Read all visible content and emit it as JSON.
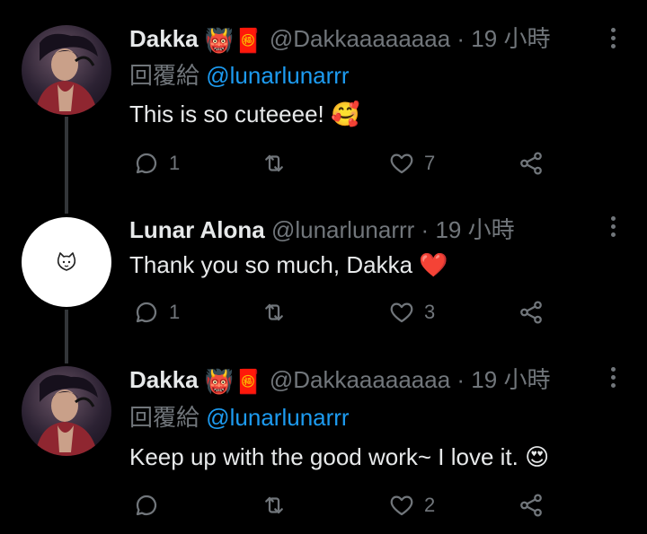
{
  "tweets": [
    {
      "name": "Dakka",
      "badges": [
        "👹",
        "🧧"
      ],
      "handle": "@Dakkaaaaaaaa",
      "dot": "·",
      "time": "19 小時",
      "reply_prefix": "回覆給",
      "reply_mention": "@lunarlunarrr",
      "text": "This is so cuteeee!",
      "text_emoji": "🥰",
      "replies": "1",
      "retweets": "",
      "likes": "7"
    },
    {
      "name": "Lunar Alona",
      "handle": "@lunarlunarrr",
      "dot": "·",
      "time": "19 小時",
      "avatar_glyph": "◕‿◕",
      "text": "Thank you so much, Dakka",
      "text_emoji": "❤️",
      "replies": "1",
      "retweets": "",
      "likes": "3"
    },
    {
      "name": "Dakka",
      "badges": [
        "👹",
        "🧧"
      ],
      "handle": "@Dakkaaaaaaaa",
      "dot": "·",
      "time": "19 小時",
      "reply_prefix": "回覆給",
      "reply_mention": "@lunarlunarrr",
      "text": "Keep up with the good work~ I love it.",
      "text_emoji": "😍",
      "replies": "",
      "retweets": "",
      "likes": "2"
    }
  ],
  "icons": {
    "reply": "reply-icon",
    "retweet": "retweet-icon",
    "like": "heart-icon",
    "share": "share-icon",
    "more": "more-icon"
  },
  "colors": {
    "background": "#000000",
    "text": "#e7e9ea",
    "muted": "#71767b",
    "link": "#1d9bf0",
    "thread_line": "#333639"
  }
}
